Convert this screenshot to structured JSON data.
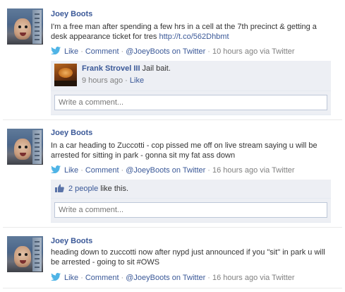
{
  "posts": [
    {
      "author": "Joey Boots",
      "message": "I'm a free man after spending a few hrs in a cell at the 7th precinct & getting a desk appearance ticket for tres ",
      "link": "http://t.co/562Dhbmt",
      "actions": {
        "like": "Like",
        "comment": "Comment",
        "via_link": "@JoeyBoots on Twitter",
        "time": "10 hours ago via Twitter"
      },
      "comment": {
        "author": "Frank Strovel III",
        "text": "Jail bait.",
        "time": "9 hours ago",
        "like": "Like"
      },
      "write_placeholder": "Write a comment..."
    },
    {
      "author": "Joey Boots",
      "message": "In a car heading to Zuccotti - cop pissed me off on live stream saying u will be arrested for sitting in park - gonna sit my fat ass down",
      "actions": {
        "like": "Like",
        "comment": "Comment",
        "via_link": "@JoeyBoots on Twitter",
        "time": "16 hours ago via Twitter"
      },
      "likes": {
        "count_link": "2 people",
        "suffix": " like this."
      },
      "write_placeholder": "Write a comment..."
    },
    {
      "author": "Joey Boots",
      "message": "heading down to zuccotti now after nypd just announced if you \"sit\" in park u will be arrested - going to sit #OWS",
      "actions": {
        "like": "Like",
        "comment": "Comment",
        "via_link": "@JoeyBoots on Twitter",
        "time": "16 hours ago via Twitter"
      }
    }
  ],
  "icons": {
    "twitter": "twitter-bird-icon",
    "like": "thumbs-up-icon"
  },
  "colors": {
    "link": "#3b5998",
    "meta": "#808080",
    "comment_bg": "#edeff4",
    "input_border": "#bdc7d8",
    "twitter": "#4fb4e6"
  }
}
